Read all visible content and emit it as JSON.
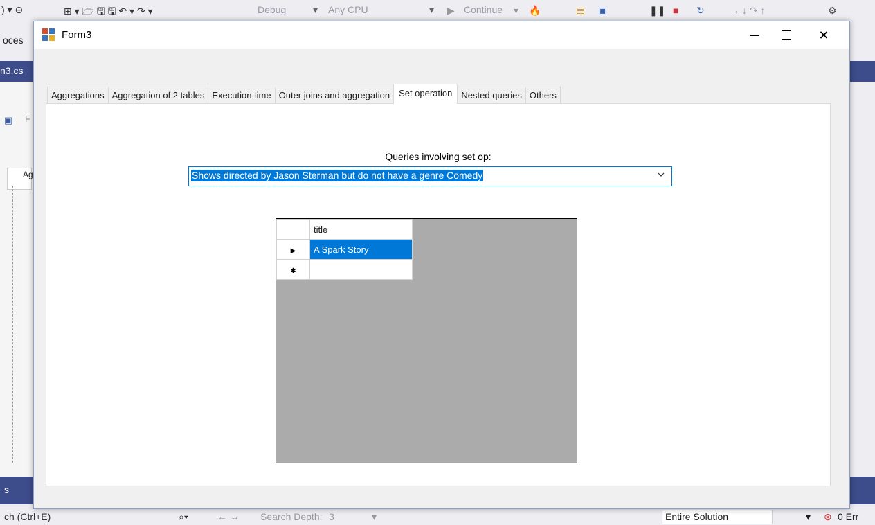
{
  "vs": {
    "toolbar": {
      "config": "Debug",
      "platform": "Any CPU",
      "continue": "Continue"
    },
    "fragments": {
      "left_process": "oces",
      "tab_file": "n3.cs",
      "side_short": "F",
      "side_tab": "Ag",
      "bottom": "s"
    },
    "searchbar": {
      "search_placeholder": "ch (Ctrl+E)",
      "search_depth_label": "Search Depth:",
      "search_depth_value": "3",
      "scope": "Entire Solution",
      "errors": "0 Err"
    }
  },
  "window": {
    "title": "Form3",
    "minimize_icon": "minimize-icon",
    "maximize_icon": "maximize-icon",
    "close_icon": "close-icon"
  },
  "tabs": [
    {
      "label": "Aggregations"
    },
    {
      "label": "Aggregation of 2 tables"
    },
    {
      "label": "Execution time"
    },
    {
      "label": "Outer joins and aggregation"
    },
    {
      "label": "Set operation",
      "active": true
    },
    {
      "label": "Nested queries"
    },
    {
      "label": "Others"
    }
  ],
  "panel": {
    "query_label": "Queries involving set op:",
    "query_selected": "Shows directed by Jason Sterman but do not have a genre Comedy"
  },
  "grid": {
    "columns": [
      "title"
    ],
    "rows": [
      {
        "title": "A Spark Story",
        "selected": true,
        "indicator": "current-row-icon"
      },
      {
        "title": "",
        "selected": false,
        "indicator": "new-row-icon"
      }
    ]
  },
  "colors": {
    "accent": "#0078d7",
    "vs_tab": "#3d4c8a",
    "grid_bg": "#ababab"
  }
}
